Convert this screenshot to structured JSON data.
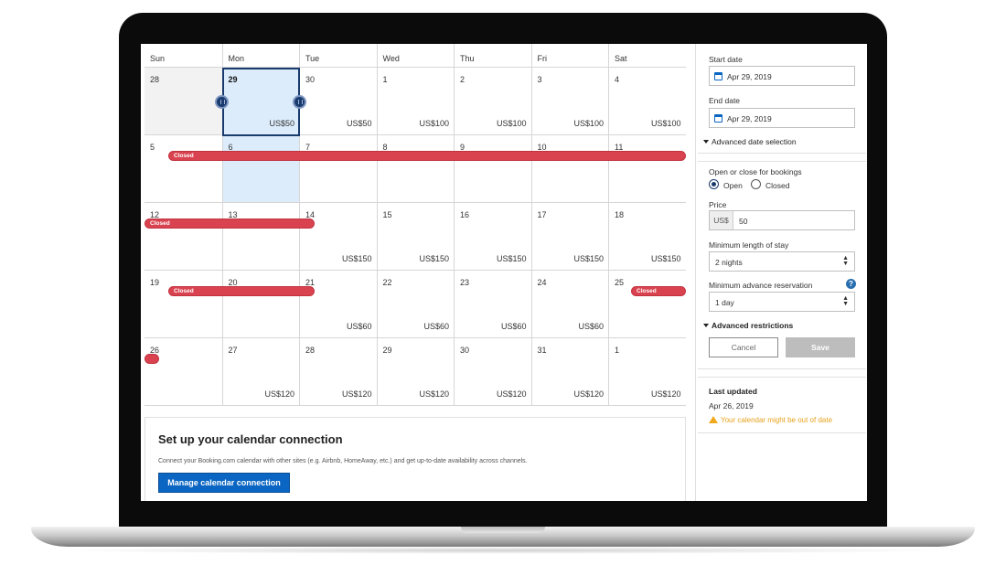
{
  "calendar": {
    "days": [
      "Sun",
      "Mon",
      "Tue",
      "Wed",
      "Thu",
      "Fri",
      "Sat"
    ],
    "weeks": [
      [
        {
          "d": "28",
          "p": "",
          "past": true
        },
        {
          "d": "29",
          "p": "US$50",
          "bold": true,
          "hl": true
        },
        {
          "d": "30",
          "p": "US$50"
        },
        {
          "d": "1",
          "p": "US$100"
        },
        {
          "d": "2",
          "p": "US$100"
        },
        {
          "d": "3",
          "p": "US$100"
        },
        {
          "d": "4",
          "p": "US$100"
        }
      ],
      [
        {
          "d": "5",
          "p": ""
        },
        {
          "d": "6",
          "p": "",
          "hl": true
        },
        {
          "d": "7",
          "p": ""
        },
        {
          "d": "8",
          "p": ""
        },
        {
          "d": "9",
          "p": ""
        },
        {
          "d": "10",
          "p": ""
        },
        {
          "d": "11",
          "p": ""
        }
      ],
      [
        {
          "d": "12",
          "p": ""
        },
        {
          "d": "13",
          "p": ""
        },
        {
          "d": "14",
          "p": "US$150"
        },
        {
          "d": "15",
          "p": "US$150"
        },
        {
          "d": "16",
          "p": "US$150"
        },
        {
          "d": "17",
          "p": "US$150"
        },
        {
          "d": "18",
          "p": "US$150"
        }
      ],
      [
        {
          "d": "19",
          "p": ""
        },
        {
          "d": "20",
          "p": ""
        },
        {
          "d": "21",
          "p": "US$60"
        },
        {
          "d": "22",
          "p": "US$60"
        },
        {
          "d": "23",
          "p": "US$60"
        },
        {
          "d": "24",
          "p": "US$60"
        },
        {
          "d": "25",
          "p": ""
        }
      ],
      [
        {
          "d": "26",
          "p": ""
        },
        {
          "d": "27",
          "p": "US$120"
        },
        {
          "d": "28",
          "p": "US$120"
        },
        {
          "d": "29",
          "p": "US$120"
        },
        {
          "d": "30",
          "p": "US$120"
        },
        {
          "d": "31",
          "p": "US$120"
        },
        {
          "d": "1",
          "p": "US$120"
        }
      ]
    ],
    "closed_label": "Closed"
  },
  "setup": {
    "title": "Set up your calendar connection",
    "description": "Connect your Booking.com calendar with other sites (e.g. Airbnb, HomeAway, etc.) and get up-to-date availability across channels.",
    "button": "Manage calendar connection"
  },
  "panel": {
    "start_label": "Start date",
    "start_value": "Apr 29, 2019",
    "end_label": "End date",
    "end_value": "Apr 29, 2019",
    "advanced_date": "Advanced date selection",
    "open_close_label": "Open or close for bookings",
    "open_label": "Open",
    "closed_label": "Closed",
    "price_label": "Price",
    "currency": "US$",
    "price_value": "50",
    "min_stay_label": "Minimum length of stay",
    "min_stay_value": "2 nights",
    "min_adv_label": "Minimum advance reservation",
    "min_adv_value": "1 day",
    "help": "?",
    "advanced_restrictions": "Advanced restrictions",
    "cancel": "Cancel",
    "save": "Save",
    "last_updated_label": "Last updated",
    "last_updated_value": "Apr 26, 2019",
    "warning": "Your calendar might be out of date"
  }
}
